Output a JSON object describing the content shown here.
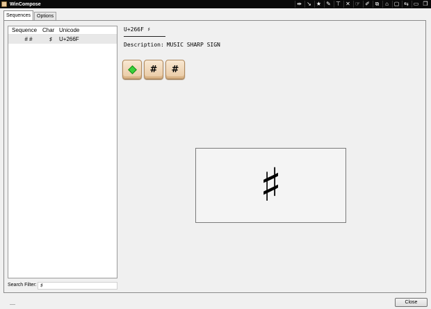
{
  "window": {
    "title": "WinCompose",
    "titlebar_icons": [
      "pin-icon",
      "download-icon",
      "star-icon",
      "text-icon",
      "filter-icon",
      "close-x-icon",
      "hand-icon",
      "edit-icon",
      "link-icon",
      "tag-icon",
      "window-icon",
      "restore-icon",
      "minimize-icon",
      "maximize-icon"
    ],
    "titlebar_glyphs": [
      "⇹",
      "↘",
      "★",
      "✎",
      "⊤",
      "✕",
      "☞",
      "✐",
      "⧉",
      "⌂",
      "▢",
      "⇆",
      "▭",
      "❐"
    ]
  },
  "tabs": [
    {
      "label": "Sequences",
      "active": true
    },
    {
      "label": "Options",
      "active": false
    }
  ],
  "list": {
    "columns": {
      "sequence": "Sequence",
      "char": "Char",
      "unicode": "Unicode"
    },
    "rows": [
      {
        "sequence": "# #",
        "char": "♯",
        "unicode": "U+266F",
        "selected": true
      }
    ]
  },
  "filter": {
    "label": "Search Filter:",
    "value": "♯"
  },
  "detail": {
    "codepoint": "U+266F ♯",
    "description_label": "Description:",
    "description_value": "MUSIC SHARP SIGN",
    "keys": [
      "compose-key",
      "#",
      "#"
    ],
    "preview_char": "♯"
  },
  "buttons": {
    "close": "Close"
  },
  "colors": {
    "compose_key_green": "#3ad13a",
    "keycap": "#f0d8b8",
    "titlebar": "#0a0a0a"
  }
}
